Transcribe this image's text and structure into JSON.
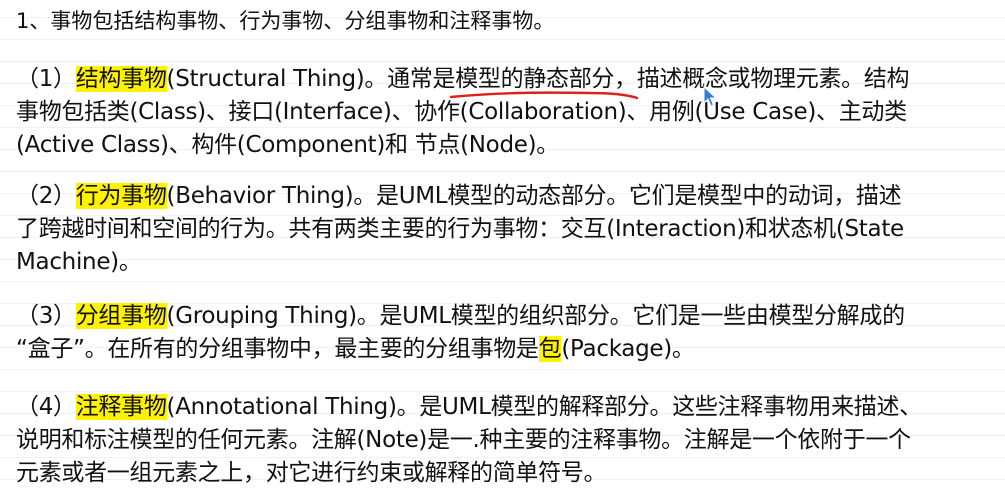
{
  "heading": "1、事物包括结构事物、行为事物、分组事物和注释事物。",
  "sections": [
    {
      "lines": [
        {
          "num": "（1）",
          "term": "结构事物",
          "s1": "(Structural Thing)。通常是",
          "annot": "模型的静态部分",
          "s2": "，描述概念或物理元素。结构"
        },
        {
          "text": "事物包括类(Class)、接口(Interface)、协作(Collaboration)、用例(Use Case)、主动类"
        },
        {
          "text": "(Active Class)、构件(Component)和 节点(Node)。"
        }
      ]
    },
    {
      "lines": [
        {
          "num": "（2）",
          "term": "行为事物",
          "rest": "(Behavior Thing)。是UML模型的动态部分。它们是模型中的动词，描述"
        },
        {
          "text": "了跨越时间和空间的行为。共有两类主要的行为事物：交互(Interaction)和状态机(State"
        },
        {
          "text": "Machine)。"
        }
      ]
    },
    {
      "lines": [
        {
          "num": "（3）",
          "term": "分组事物",
          "rest": "(Grouping Thing)。是UML模型的组织部分。它们是一些由模型分解成的"
        },
        {
          "pre": "“盒子”。在所有的分组事物中，最主要的分组事物是",
          "hl": "包",
          "post": "(Package)。"
        }
      ]
    },
    {
      "lines": [
        {
          "num": "（4）",
          "term": "注释事物",
          "rest": "(Annotational Thing)。是UML模型的解释部分。这些注释事物用来描述、"
        },
        {
          "text": "说明和标注模型的任何元素。注解(Note)是一.种主要的注释事物。注解是一个依附于一个"
        },
        {
          "text": "元素或者一组元素之上，对它进行约束或解释的简单符号。"
        }
      ]
    }
  ],
  "colors": {
    "highlight": "#fff200",
    "annotation_stroke": "#e0201a",
    "cursor_fill": "#2f7fd8"
  },
  "icons": [
    "mouse-pointer-icon"
  ]
}
